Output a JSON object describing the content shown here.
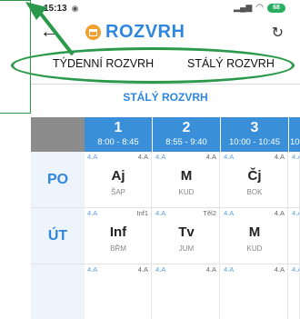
{
  "status_bar": {
    "time": "15:13",
    "battery": "68"
  },
  "app_bar": {
    "back_icon": "arrow-left-icon",
    "title": "ROZVRH",
    "refresh_icon": "refresh-icon"
  },
  "tabs": [
    {
      "label": "TÝDENNÍ ROZVRH"
    },
    {
      "label": "STÁLÝ ROZVRH"
    }
  ],
  "section_title": "STÁLÝ ROZVRH",
  "periods": [
    {
      "num": "1",
      "time": "8:00 - 8:45"
    },
    {
      "num": "2",
      "time": "8:55 - 9:40"
    },
    {
      "num": "3",
      "time": "10:00 - 10:45"
    },
    {
      "num": "4",
      "time": "10:"
    }
  ],
  "days": [
    {
      "label": "PO",
      "lessons": [
        {
          "group": "4.A",
          "room": "4.A",
          "subject": "Aj",
          "teacher": "ŠAP"
        },
        {
          "group": "4.A",
          "room": "4.A",
          "subject": "M",
          "teacher": "KUD"
        },
        {
          "group": "4.A",
          "room": "4.A",
          "subject": "Čj",
          "teacher": "BOK"
        },
        {
          "group": "4.A",
          "room": "",
          "subject": "",
          "teacher": ""
        }
      ]
    },
    {
      "label": "ÚT",
      "lessons": [
        {
          "group": "4.A",
          "room": "Inf1",
          "subject": "Inf",
          "teacher": "BŘM"
        },
        {
          "group": "4.A",
          "room": "Těl2",
          "subject": "Tv",
          "teacher": "JUM"
        },
        {
          "group": "4.A",
          "room": "4.A",
          "subject": "M",
          "teacher": "KUD"
        },
        {
          "group": "4.A",
          "room": "",
          "subject": "",
          "teacher": ""
        }
      ]
    },
    {
      "label": "",
      "lessons": [
        {
          "group": "4.A",
          "room": "4.A",
          "subject": "",
          "teacher": ""
        },
        {
          "group": "4.A",
          "room": "4.A",
          "subject": "",
          "teacher": ""
        },
        {
          "group": "4.A",
          "room": "4.A",
          "subject": "",
          "teacher": ""
        },
        {
          "group": "4.A",
          "room": "",
          "subject": "",
          "teacher": ""
        }
      ]
    }
  ],
  "colors": {
    "accent": "#2e86de",
    "header": "#3a8fd9",
    "annotation": "#2a9a4a",
    "logo": "#f0a02d"
  }
}
